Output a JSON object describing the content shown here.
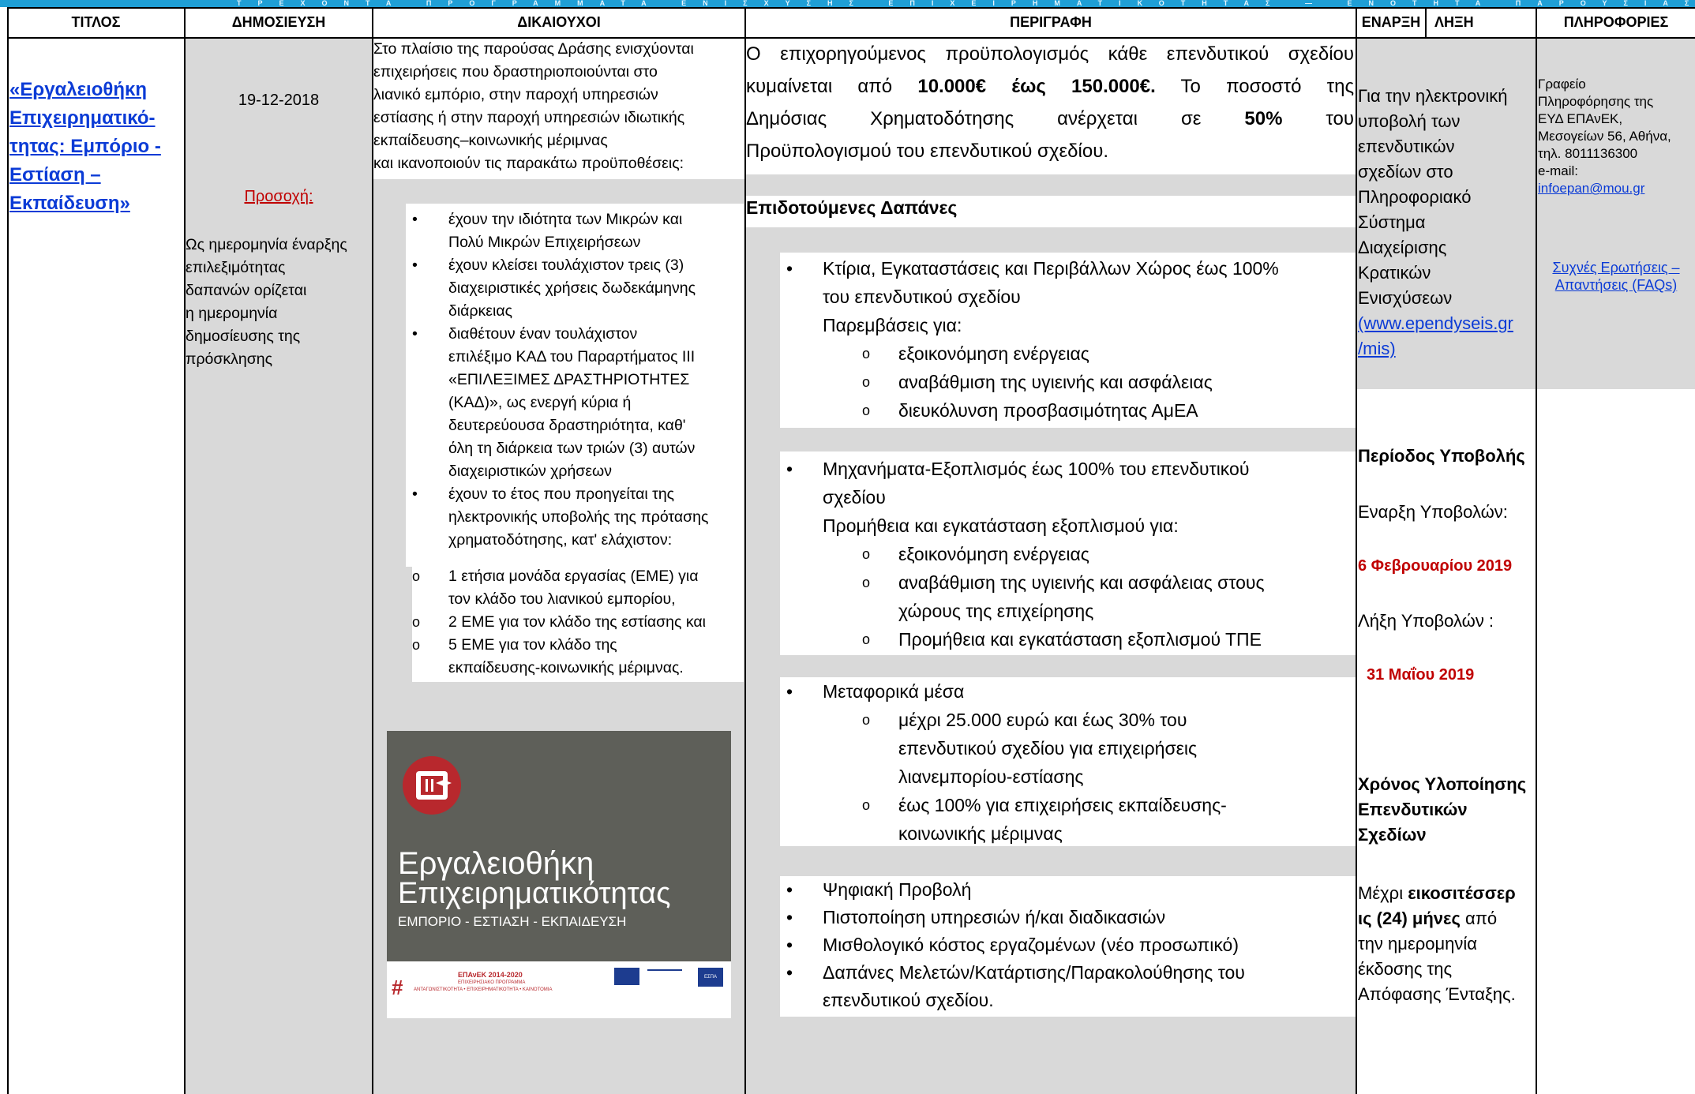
{
  "banner": "ΤΡΕΧΟΝΤΑ ΠΡΟΓΡΑΜΜΑΤΑ ΕΝΙΣΧΥΣΗΣ ΕΠΙΧΕΙΡΗΜΑΤΙΚΟΤΗΤΑΣ — ΕΝΟΤΗΤΑ ΠΑΡΟΥΣΙΑΣΗΣ",
  "headers": {
    "title": "ΤΙΤΛΟΣ",
    "publication": "ΔΗΜΟΣΙΕΥΣΗ",
    "beneficiaries": "ΔΙΚΑΙΟΥΧΟΙ",
    "description": "ΠΕΡΙΓΡΑΦΗ",
    "start": "ΕΝΑΡΞΗ",
    "end": "ΛΗΞΗ",
    "info": "ΠΛΗΡΟΦΟΡΙΕΣ"
  },
  "title_col": {
    "link_lines": [
      "«Εργαλειοθήκη ",
      "Επιχειρηματικό-",
      "τητας: Εμπόριο - ",
      "Εστίαση – ",
      "Εκπαίδευση»"
    ]
  },
  "publication_col": {
    "date": "19-12-2018",
    "notice_label": "Προσοχή:",
    "notice_lines": [
      "Ως ημερομηνία έναρξης",
      "επιλεξιμότητας",
      "δαπανών ορίζεται",
      "η ημερομηνία",
      "δημοσίευσης της",
      "πρόσκλησης"
    ]
  },
  "beneficiaries_col": {
    "intro_lines": [
      "Στο πλαίσιο της παρούσας Δράσης ενισχύονται",
      "επιχειρήσεις που δραστηριοποιούνται στο",
      "λιανικό εμπόριο, στην παροχή υπηρεσιών",
      "εστίασης ή στην παροχή υπηρεσιών ιδιωτικής",
      "εκπαίδευσης–κοινωνικής μέριμνας",
      "και  ικανοποιούν τις παρακάτω προϋποθέσεις:"
    ],
    "criteria": [
      [
        "έχουν την ιδιότητα των Μικρών και",
        "Πολύ Μικρών Επιχειρήσεων"
      ],
      [
        "έχουν κλείσει τουλάχιστον τρεις (3)",
        "διαχειριστικές χρήσεις δωδεκάμηνης",
        "διάρκειας"
      ],
      [
        "διαθέτουν έναν τουλάχιστον",
        "επιλέξιμο ΚΑΔ του Παραρτήματος ΙΙΙ",
        "«ΕΠΙΛΕΞΙΜΕΣ ΔΡΑΣΤΗΡΙΟΤΗΤΕΣ",
        "(ΚΑΔ)», ως ενεργή κύρια ή",
        "δευτερεύουσα δραστηριότητα, καθ'",
        "όλη τη διάρκεια των τριών (3) αυτών",
        "διαχειριστικών χρήσεων"
      ],
      [
        "έχουν το έτος που προηγείται της",
        "ηλεκτρονικής υποβολής της πρότασης",
        "χρηματοδότησης, κατ' ελάχιστον:"
      ]
    ],
    "sub_criteria": [
      [
        "1 ετήσια μονάδα εργασίας (ΕΜΕ) για",
        "τον κλάδο του λιανικού εμπορίου,"
      ],
      [
        "2 ΕΜΕ για τον κλάδο της εστίασης και"
      ],
      [
        "5 ΕΜΕ για τον κλάδο της",
        "εκπαίδευσης-κοινωνικής μέριμνας."
      ]
    ],
    "logo": {
      "title_line1": "Εργαλειοθήκη",
      "title_line2": "Επιχειρηματικότητας",
      "subtitle": "ΕΜΠΟΡΙΟ - ΕΣΤΙΑΣΗ - ΕΚΠΑΙΔΕΥΣΗ",
      "program": "ΕΠΑνΕΚ 2014-2020",
      "program_sub1": "ΕΠΙΧΕΙΡΗΣΙΑΚΟ ΠΡΟΓΡΑΜΜΑ",
      "program_sub2": "ΑΝΤΑΓΩΝΙΣΤΙΚΟΤΗΤΑ • ΕΠΙΧΕΙΡΗΜΑΤΙΚΟΤΗΤΑ • ΚΑΙΝΟΤΟΜΙΑ",
      "espa": "ΕΣΠΑ 2014-2020"
    }
  },
  "description_col": {
    "budget_lines": [
      [
        "Ο επιχορηγούμενος προϋπολογισμός κάθε επενδυτικού σχεδίου"
      ],
      [
        "κυμαίνεται από ",
        "10.000€ έως 150.000€.",
        " Το ποσοστό της"
      ],
      [
        "Δημόσιας Χρηματοδότησης ανέρχεται σε ",
        "50%",
        " του"
      ],
      [
        "Προϋπολογισμού του επενδυτικού σχεδίου."
      ]
    ],
    "expenses_heading": "Επιδοτούμενες Δαπάνες",
    "group1": {
      "bullet_lines": [
        "Κτίρια, Εγκαταστάσεις και Περιβάλλων Χώρος έως 100%",
        "του επενδυτικού σχεδίου"
      ],
      "sub_heading": "Παρεμβάσεις για:",
      "items": [
        [
          "εξοικονόμηση ενέργειας"
        ],
        [
          "αναβάθμιση της υγιεινής και ασφάλειας"
        ],
        [
          "διευκόλυνση προσβασιμότητας ΑμΕΑ"
        ]
      ]
    },
    "group2": {
      "bullet_lines": [
        "Μηχανήματα-Εξοπλισμός έως  100% του επενδυτικού",
        "σχεδίου"
      ],
      "sub_heading": "Προμήθεια και εγκατάσταση εξοπλισμού για:",
      "items": [
        [
          "εξοικονόμηση ενέργειας"
        ],
        [
          "αναβάθμιση της υγιεινής και ασφάλειας στους",
          "χώρους της επιχείρησης"
        ],
        [
          "Προμήθεια και εγκατάσταση εξοπλισμού ΤΠΕ"
        ]
      ]
    },
    "group3": {
      "bullet_lines": [
        "Μεταφορικά μέσα"
      ],
      "items": [
        [
          "μέχρι 25.000 ευρώ και έως 30% του",
          "επενδυτικού σχεδίου για επιχειρήσεις",
          "λιανεμπορίου-εστίασης"
        ],
        [
          "έως 100% για επιχειρήσεις εκπαίδευσης-",
          "κοινωνικής μέριμνας"
        ]
      ]
    },
    "group4": [
      [
        "Ψηφιακή Προβολή"
      ],
      [
        "Πιστοποίηση υπηρεσιών ή/και διαδικασιών"
      ],
      [
        "Μισθολογικό κόστος εργαζομένων (νέο προσωπικό)"
      ],
      [
        "Δαπάνες Μελετών/Κατάρτισης/Παρακολούθησης του",
        "επενδυτικού σχεδίου."
      ]
    ]
  },
  "dates_col": {
    "submission_lines": [
      "Για την ηλεκτρονική",
      "υποβολή των",
      "επενδυτικών",
      "σχεδίων στο",
      "Πληροφοριακό",
      "Σύστημα",
      "Διαχείρισης",
      "Κρατικών",
      "Ενισχύσεων"
    ],
    "mis_link_lines": [
      "(www.ependyseis.gr",
      "/mis)"
    ],
    "period_label": "Περίοδος Υποβολής",
    "start_label": "Εναρξη Υποβολών:",
    "start_date": "6 Φεβρουαρίου 2019",
    "end_label": "Λήξη Υποβολών :",
    "end_date": "31 Μαΐου 2019",
    "impl_label_lines": [
      "Χρόνος Υλοποίησης",
      "Επενδυτικών",
      "Σχεδίων"
    ],
    "impl_prefix": "Μέχρι ",
    "impl_bold1": "εικοσιτέσσερ",
    "impl_bold2": "ις (24) μήνες",
    "impl_suffix": " από",
    "impl_rest": [
      "την ημερομηνία",
      "έκδοσης της",
      "Απόφασης Ένταξης."
    ]
  },
  "info_col": {
    "office_lines": [
      "Γραφείο",
      "Πληροφόρησης της",
      "ΕΥΔ ΕΠΑνΕΚ,",
      "Μεσογείων 56, Αθήνα,",
      "τηλ. 8011136300",
      "e-mail:"
    ],
    "email": "infoepan@mou.gr",
    "faq_lines": [
      "Συχνές Ερωτήσεις –",
      "Απαντήσεις (FAQs)"
    ]
  },
  "colors": {
    "banner": "#1f9fd6",
    "link": "#0b3bd6",
    "red": "#c00000",
    "gray": "#d9d9d9",
    "logo_bg": "#5e5f59",
    "logo_red": "#b8282d"
  }
}
